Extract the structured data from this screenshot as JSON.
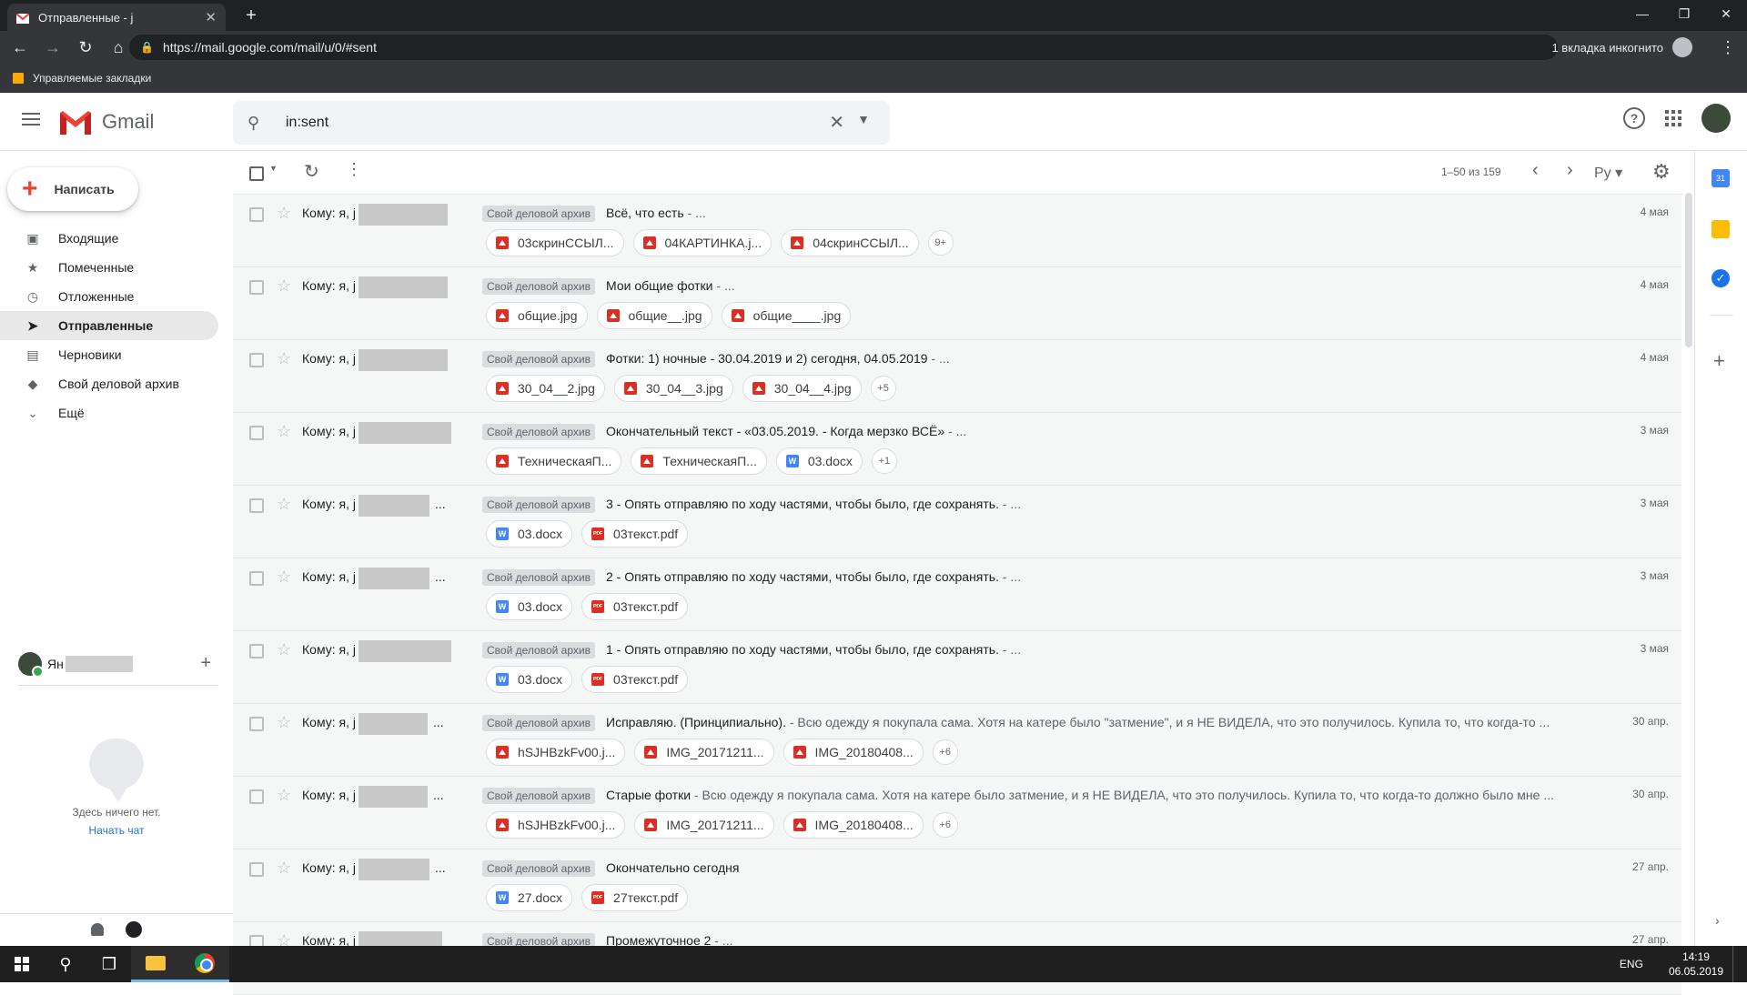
{
  "browser": {
    "tab_title": "Отправленные - j",
    "url": "https://mail.google.com/mail/u/0/#sent",
    "incognito_label": "1 вкладка инкогнито",
    "bookmarks_folder": "Управляемые закладки"
  },
  "header": {
    "product": "Gmail",
    "search_value": "in:sent"
  },
  "sidebar": {
    "compose_label": "Написать",
    "items": [
      {
        "label": "Входящие",
        "icon": "inbox-icon"
      },
      {
        "label": "Помеченные",
        "icon": "star-icon"
      },
      {
        "label": "Отложенные",
        "icon": "clock-icon"
      },
      {
        "label": "Отправленные",
        "icon": "send-icon"
      },
      {
        "label": "Черновики",
        "icon": "draft-icon"
      },
      {
        "label": "Свой деловой архив",
        "icon": "label-icon"
      },
      {
        "label": "Ещё",
        "icon": "chevron-down-icon"
      }
    ],
    "hangouts_name": "Ян",
    "chat_empty": "Здесь ничего нет.",
    "chat_start": "Начать чат"
  },
  "toolbar": {
    "count": "1–50 из 159",
    "lang": "Ру"
  },
  "messages": [
    {
      "to": "Кому: я, j",
      "ellipsis": "",
      "label": "Свой деловой архив",
      "subject": "Всё, что есть",
      "snippet": " - ...",
      "date": "4 мая",
      "attachments": [
        {
          "type": "img",
          "name": "03скринССЫЛ..."
        },
        {
          "type": "img",
          "name": "04КАРТИНКА.j..."
        },
        {
          "type": "img",
          "name": "04скринССЫЛ..."
        }
      ],
      "more": "9+"
    },
    {
      "to": "Кому: я, j",
      "ellipsis": "",
      "label": "Свой деловой архив",
      "subject": "Мои общие фотки",
      "snippet": " - ...",
      "date": "4 мая",
      "attachments": [
        {
          "type": "img",
          "name": "общие.jpg"
        },
        {
          "type": "img",
          "name": "общие__.jpg"
        },
        {
          "type": "img",
          "name": "общие____.jpg"
        }
      ],
      "more": ""
    },
    {
      "to": "Кому: я, j",
      "ellipsis": "",
      "label": "Свой деловой архив",
      "subject": "Фотки: 1) ночные - 30.04.2019 и 2) сегодня, 04.05.2019",
      "snippet": " - ...",
      "date": "4 мая",
      "attachments": [
        {
          "type": "img",
          "name": "30_04__2.jpg"
        },
        {
          "type": "img",
          "name": "30_04__3.jpg"
        },
        {
          "type": "img",
          "name": "30_04__4.jpg"
        }
      ],
      "more": "+5"
    },
    {
      "to": "Кому: я, j",
      "ellipsis": "",
      "label": "Свой деловой архив",
      "subject": "Окончательный текст - «03.05.2019. - Когда мерзко ВСЁ»",
      "snippet": " - ...",
      "date": "3 мая",
      "attachments": [
        {
          "type": "img",
          "name": "ТехническаяП..."
        },
        {
          "type": "img",
          "name": "ТехническаяП..."
        },
        {
          "type": "doc",
          "name": "03.docx"
        }
      ],
      "more": "+1"
    },
    {
      "to": "Кому: я, j",
      "ellipsis": "...",
      "label": "Свой деловой архив",
      "subject": "3 - Опять отправляю по ходу частями, чтобы было, где сохранять.",
      "snippet": " - ...",
      "date": "3 мая",
      "attachments": [
        {
          "type": "doc",
          "name": "03.docx"
        },
        {
          "type": "pdf",
          "name": "03текст.pdf"
        }
      ],
      "more": ""
    },
    {
      "to": "Кому: я, j",
      "ellipsis": "...",
      "label": "Свой деловой архив",
      "subject": "2 - Опять отправляю по ходу частями, чтобы было, где сохранять.",
      "snippet": " - ...",
      "date": "3 мая",
      "attachments": [
        {
          "type": "doc",
          "name": "03.docx"
        },
        {
          "type": "pdf",
          "name": "03текст.pdf"
        }
      ],
      "more": ""
    },
    {
      "to": "Кому: я, j",
      "ellipsis": "",
      "label": "Свой деловой архив",
      "subject": "1 - Опять отправляю по ходу частями, чтобы было, где сохранять.",
      "snippet": " - ...",
      "date": "3 мая",
      "attachments": [
        {
          "type": "doc",
          "name": "03.docx"
        },
        {
          "type": "pdf",
          "name": "03текст.pdf"
        }
      ],
      "more": ""
    },
    {
      "to": "Кому: я, j",
      "ellipsis": "...",
      "label": "Свой деловой архив",
      "subject": "Исправляю. (Принципиально).",
      "snippet": " - Всю одежду я покупала сама. Хотя на катере было \"затмение\", и я НЕ ВИДЕЛА, что это получилось. Купила то, что когда-то ...",
      "date": "30 апр.",
      "attachments": [
        {
          "type": "img",
          "name": "hSJHBzkFv00.j..."
        },
        {
          "type": "img",
          "name": "IMG_20171211..."
        },
        {
          "type": "img",
          "name": "IMG_20180408..."
        }
      ],
      "more": "+6"
    },
    {
      "to": "Кому: я, j",
      "ellipsis": "...",
      "label": "Свой деловой архив",
      "subject": "Старые фотки",
      "snippet": " - Всю одежду я покупала сама. Хотя на катере было затмение, и я НЕ ВИДЕЛА, что это получилось. Купила то, что когда-то должно было мне ...",
      "date": "30 апр.",
      "attachments": [
        {
          "type": "img",
          "name": "hSJHBzkFv00.j..."
        },
        {
          "type": "img",
          "name": "IMG_20171211..."
        },
        {
          "type": "img",
          "name": "IMG_20180408..."
        }
      ],
      "more": "+6"
    },
    {
      "to": "Кому: я, j",
      "ellipsis": "...",
      "label": "Свой деловой архив",
      "subject": "Окончательно сегодня",
      "snippet": "",
      "date": "27 апр.",
      "attachments": [
        {
          "type": "doc",
          "name": "27.docx"
        },
        {
          "type": "pdf",
          "name": "27текст.pdf"
        }
      ],
      "more": ""
    },
    {
      "to": "Кому: я, j",
      "ellipsis": "",
      "label": "Свой деловой архив",
      "subject": "Промежуточное 2",
      "snippet": " - ...",
      "date": "27 апр.",
      "attachments": [],
      "more": ""
    }
  ],
  "taskbar": {
    "lang": "ENG",
    "time": "14:19",
    "date": "06.05.2019"
  }
}
